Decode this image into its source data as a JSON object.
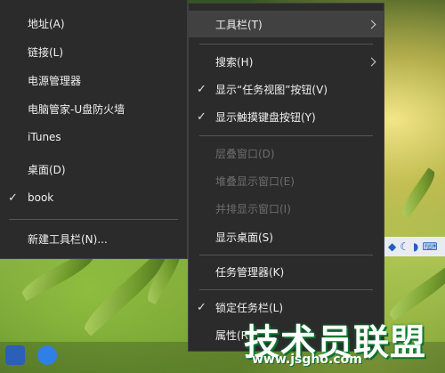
{
  "left_menu": {
    "items": [
      {
        "label": "地址(A)",
        "checked": false
      },
      {
        "label": "链接(L)",
        "checked": false
      },
      {
        "label": "电源管理器",
        "checked": false
      },
      {
        "label": "电脑管家-U盘防火墙",
        "checked": false
      },
      {
        "label": "iTunes",
        "checked": false
      },
      {
        "label": "桌面(D)",
        "checked": false
      },
      {
        "label": "book",
        "checked": true
      },
      {
        "label": "新建工具栏(N)...",
        "checked": false
      }
    ],
    "check_glyph": "✓"
  },
  "right_menu": {
    "items": [
      {
        "label": "工具栏(T)",
        "submenu": true,
        "highlighted": true
      },
      {
        "label": "搜索(H)",
        "submenu": true
      },
      {
        "label": "显示“任务视图”按钮(V)",
        "checked": true
      },
      {
        "label": "显示触摸键盘按钮(Y)",
        "checked": true
      },
      {
        "label": "层叠窗口(D)",
        "disabled": true
      },
      {
        "label": "堆叠显示窗口(E)",
        "disabled": true
      },
      {
        "label": "并排显示窗口(I)",
        "disabled": true
      },
      {
        "label": "显示桌面(S)"
      },
      {
        "label": "任务管理器(K)"
      },
      {
        "label": "锁定任务栏(L)",
        "checked": true
      },
      {
        "label": "属性(R)"
      }
    ],
    "check_glyph": "✓"
  },
  "watermark": {
    "title": "技术员联盟",
    "url": "www.jsgho.com"
  },
  "colors": {
    "menu_bg": "#2b2b2b",
    "menu_text": "#f0f0f0",
    "disabled_text": "#6d6d6d",
    "highlight_bg": "#414141",
    "separator": "#555555"
  }
}
